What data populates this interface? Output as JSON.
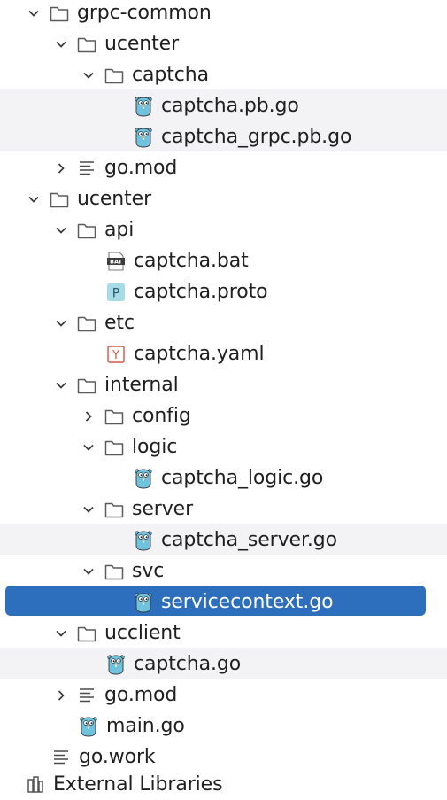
{
  "tree": {
    "items": [
      {
        "label": "grpc-common",
        "type": "folder",
        "expanded": true,
        "depth": 0
      },
      {
        "label": "ucenter",
        "type": "folder",
        "expanded": true,
        "depth": 1
      },
      {
        "label": "captcha",
        "type": "folder",
        "expanded": true,
        "depth": 2
      },
      {
        "label": "captcha.pb.go",
        "type": "go",
        "depth": 3
      },
      {
        "label": "captcha_grpc.pb.go",
        "type": "go",
        "depth": 3
      },
      {
        "label": "go.mod",
        "type": "mod",
        "expanded": false,
        "depth": 1
      },
      {
        "label": "ucenter",
        "type": "folder",
        "expanded": true,
        "depth": 0
      },
      {
        "label": "api",
        "type": "folder",
        "expanded": true,
        "depth": 1
      },
      {
        "label": "captcha.bat",
        "type": "bat",
        "depth": 2
      },
      {
        "label": "captcha.proto",
        "type": "proto",
        "depth": 2
      },
      {
        "label": "etc",
        "type": "folder",
        "expanded": true,
        "depth": 1
      },
      {
        "label": "captcha.yaml",
        "type": "yaml",
        "depth": 2
      },
      {
        "label": "internal",
        "type": "folder",
        "expanded": true,
        "depth": 1
      },
      {
        "label": "config",
        "type": "folder",
        "expanded": false,
        "depth": 2
      },
      {
        "label": "logic",
        "type": "folder",
        "expanded": true,
        "depth": 2
      },
      {
        "label": "captcha_logic.go",
        "type": "go",
        "depth": 3
      },
      {
        "label": "server",
        "type": "folder",
        "expanded": true,
        "depth": 2
      },
      {
        "label": "captcha_server.go",
        "type": "go",
        "depth": 3
      },
      {
        "label": "svc",
        "type": "folder",
        "expanded": true,
        "depth": 2
      },
      {
        "label": "servicecontext.go",
        "type": "go",
        "depth": 3,
        "selected": true
      },
      {
        "label": "ucclient",
        "type": "folder",
        "expanded": true,
        "depth": 1
      },
      {
        "label": "captcha.go",
        "type": "go",
        "depth": 2
      },
      {
        "label": "go.mod",
        "type": "mod",
        "expanded": false,
        "depth": 1
      },
      {
        "label": "main.go",
        "type": "go",
        "depth": 1
      },
      {
        "label": "go.work",
        "type": "work",
        "depth": 0
      }
    ],
    "external_libraries": "External Libraries"
  },
  "colors": {
    "selection": "#2e6fbd",
    "row_highlight": "#f3f3f5",
    "gopher": "#6fc3df",
    "proto_icon": "#a7dbe6",
    "yaml_icon": "#d9534f"
  }
}
